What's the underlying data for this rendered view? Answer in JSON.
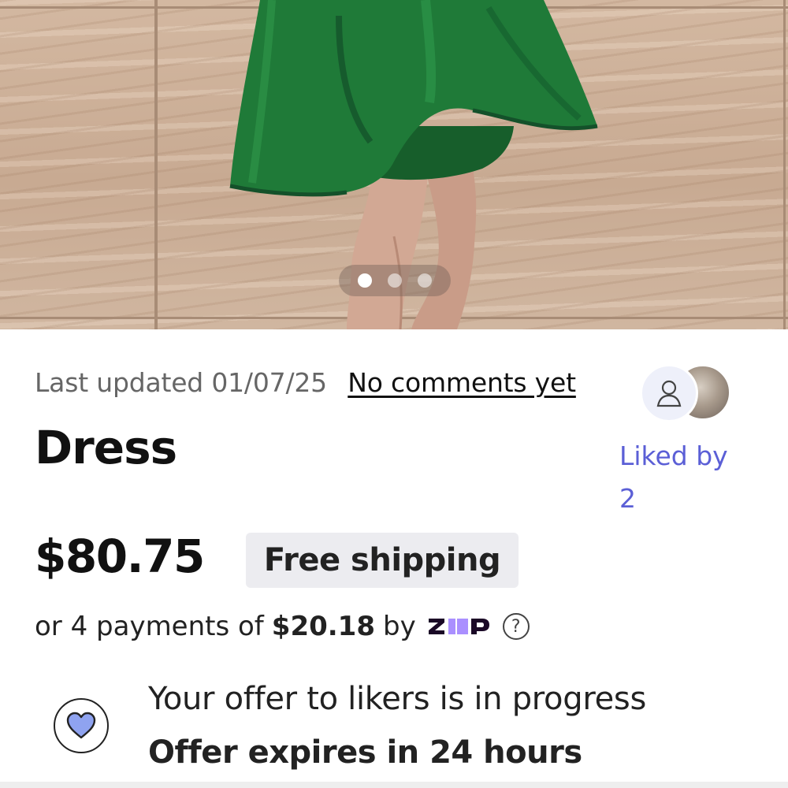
{
  "carousel": {
    "total_images": 3,
    "active_index": 0
  },
  "listing": {
    "last_updated": "Last updated 01/07/25",
    "comments_link": "No comments yet",
    "title": "Dress",
    "price": "$80.75",
    "shipping_badge": "Free shipping",
    "liked_by_label": "Liked by",
    "liked_by_count": "2"
  },
  "payments": {
    "prefix": "or 4 payments of",
    "amount": "$20.18",
    "suffix": "by",
    "provider": "zip",
    "help_icon": "question-circle-icon"
  },
  "offer": {
    "icon": "heart-icon",
    "status": "Your offer to likers is in progress",
    "expiry": "Offer expires in 24 hours"
  },
  "colors": {
    "accent": "#5b5fd6",
    "dress_green": "#1f7a38",
    "heart_fill": "#8fa3f0"
  }
}
